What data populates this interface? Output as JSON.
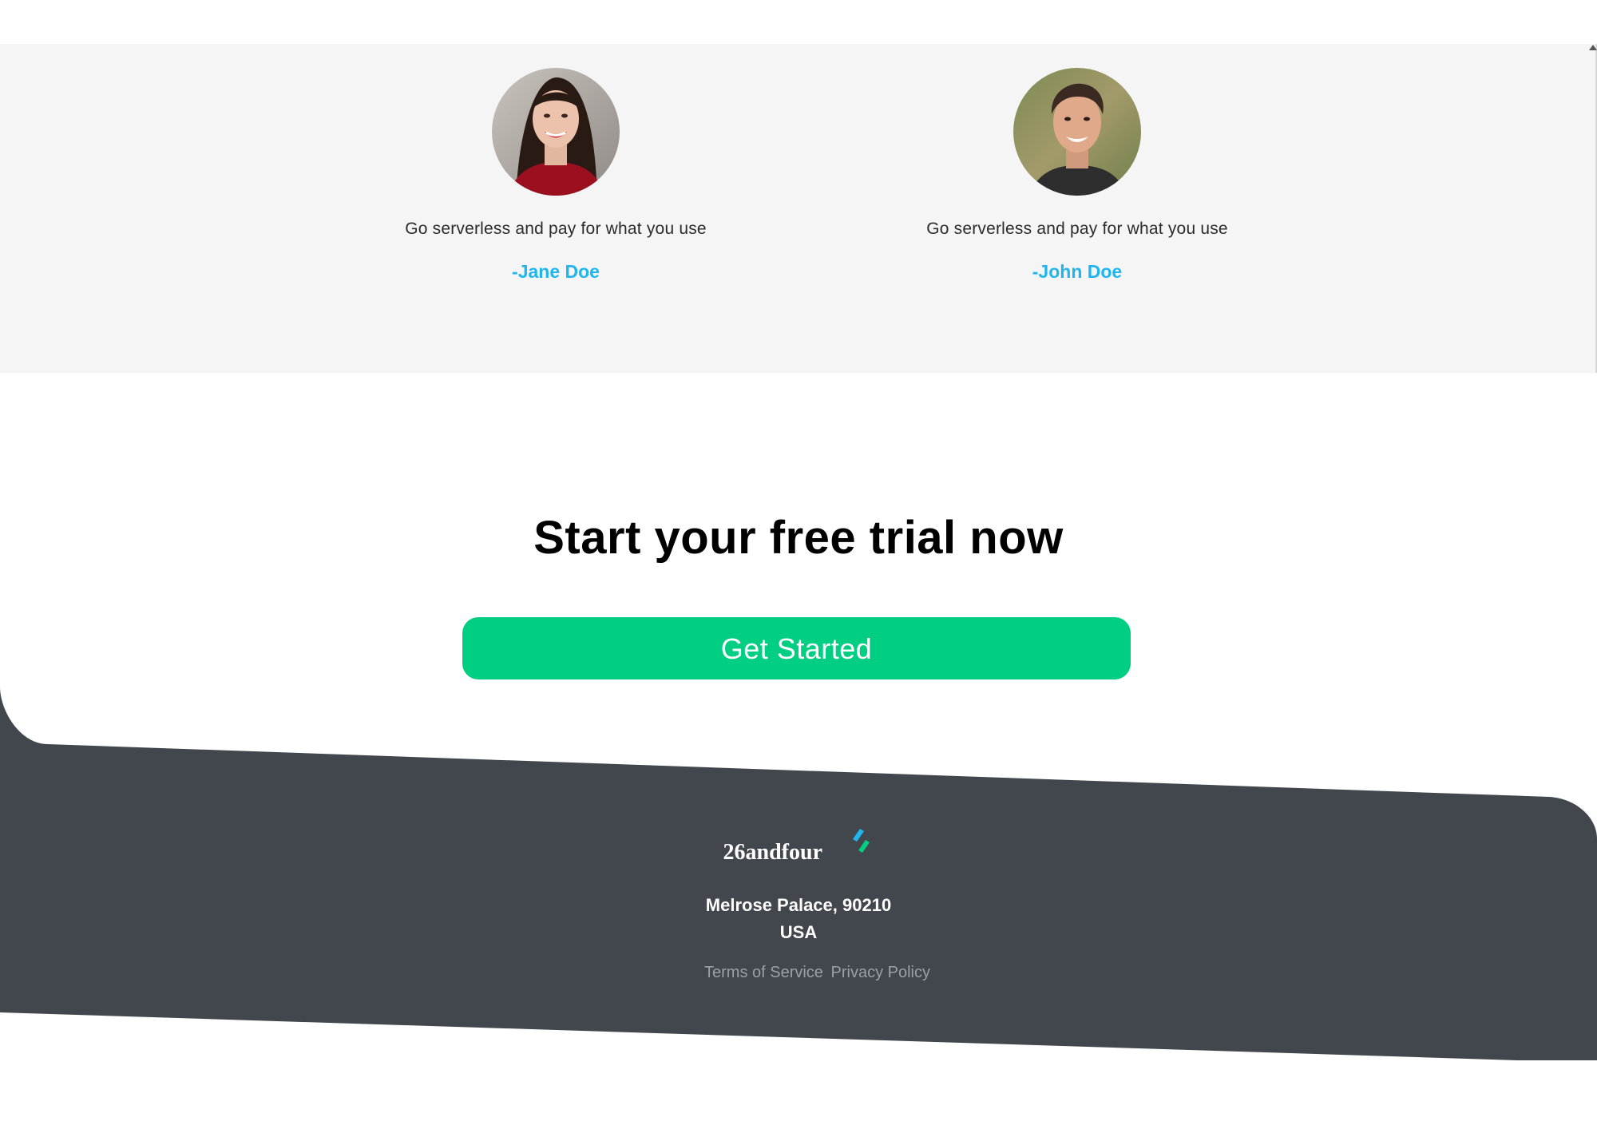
{
  "testimonials": [
    {
      "quote": "Go serverless and pay for what you use",
      "author": "-Jane Doe",
      "avatar": "woman-portrait"
    },
    {
      "quote": "Go serverless and pay for what you use",
      "author": "-John Doe",
      "avatar": "man-portrait"
    }
  ],
  "cta": {
    "title": "Start your free trial now",
    "button_label": "Get Started"
  },
  "footer": {
    "brand": "26andfour",
    "logo_icon": "double-slash-logo-icon",
    "address_line1": "Melrose Palace, 90210",
    "address_line2": "USA",
    "links": {
      "terms": "Terms of Service",
      "privacy": "Privacy Policy"
    }
  },
  "colors": {
    "accent_green": "#00ce82",
    "author_blue": "#1fb6f0",
    "footer_bg": "#41474c",
    "band_bg": "#f5f5f5",
    "logo_blue": "#1fb6f0",
    "logo_green": "#00ce82"
  }
}
